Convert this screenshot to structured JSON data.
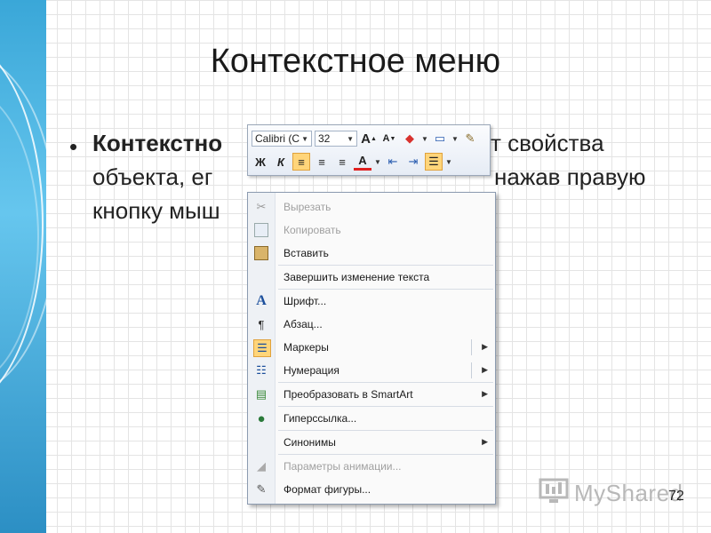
{
  "slide": {
    "title": "Контекстное меню",
    "bullet_symbol": "•",
    "line1_bold": "Контекстно",
    "line1_rest": "т свойства",
    "line2_start": "объекта, ег",
    "line2_end": "нажав правую",
    "line3_start": "кнопку мыш",
    "page_number": "72"
  },
  "mini_toolbar": {
    "font_name": "Calibri (С",
    "font_size": "32",
    "row1_buttons": [
      {
        "name": "grow-font",
        "glyph": "A"
      },
      {
        "name": "shrink-font",
        "glyph": "A"
      },
      {
        "name": "fill-color",
        "glyph": "◆"
      },
      {
        "name": "outline-color",
        "glyph": "▭"
      },
      {
        "name": "format-painter",
        "glyph": "✎"
      }
    ],
    "row2_buttons": [
      {
        "name": "bold",
        "glyph": "Ж"
      },
      {
        "name": "italic",
        "glyph": "К"
      },
      {
        "name": "align-left",
        "glyph": "≡"
      },
      {
        "name": "align-center",
        "glyph": "≡"
      },
      {
        "name": "align-right",
        "glyph": "≡"
      },
      {
        "name": "font-color",
        "glyph": "A"
      },
      {
        "name": "decrease-indent",
        "glyph": "⇤"
      },
      {
        "name": "increase-indent",
        "glyph": "⇥"
      },
      {
        "name": "bullets",
        "glyph": "☰"
      }
    ]
  },
  "context_menu": {
    "items": [
      {
        "label": "Вырезать",
        "icon": "scissors-icon",
        "disabled": true
      },
      {
        "label": "Копировать",
        "icon": "copy-icon",
        "disabled": true
      },
      {
        "label": "Вставить",
        "icon": "paste-icon",
        "disabled": false
      },
      {
        "label": "Завершить изменение текста",
        "icon": "",
        "disabled": false
      },
      {
        "label": "Шрифт...",
        "icon": "font-icon",
        "disabled": false
      },
      {
        "label": "Абзац...",
        "icon": "paragraph-icon",
        "disabled": false
      },
      {
        "label": "Маркеры",
        "icon": "bullets-icon",
        "disabled": false,
        "submenu": true
      },
      {
        "label": "Нумерация",
        "icon": "numbering-icon",
        "disabled": false,
        "submenu": true
      },
      {
        "label": "Преобразовать в SmartArt",
        "icon": "smartart-icon",
        "disabled": false,
        "submenu": true
      },
      {
        "label": "Гиперссылка...",
        "icon": "hyperlink-icon",
        "disabled": false
      },
      {
        "label": "Синонимы",
        "icon": "",
        "disabled": false,
        "submenu": true
      },
      {
        "label": "Параметры анимации...",
        "icon": "animation-icon",
        "disabled": true
      },
      {
        "label": "Формат фигуры...",
        "icon": "format-shape-icon",
        "disabled": false
      }
    ]
  },
  "watermark": {
    "text": "MyShared"
  },
  "colors": {
    "accent": "#3aa7d8",
    "highlight": "#ffd57a"
  }
}
